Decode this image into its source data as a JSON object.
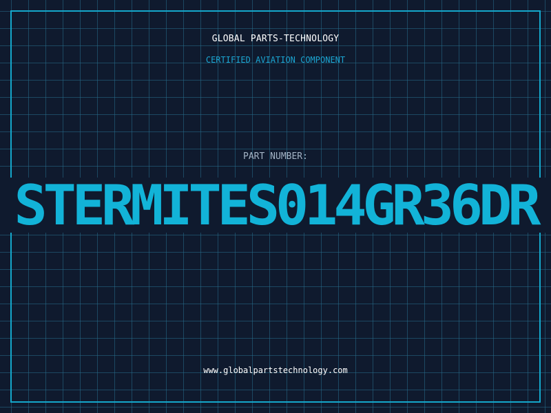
{
  "header": {
    "company": "GLOBAL PARTS-TECHNOLOGY",
    "tagline": "CERTIFIED AVIATION COMPONENT"
  },
  "part": {
    "label": "PART NUMBER:",
    "number": "STERMITES014GR36DR"
  },
  "footer": {
    "url": "www.globalpartstechnology.com"
  },
  "colors": {
    "background": "#0f1a2e",
    "accent": "#14a8cc",
    "grid": "#266e8c",
    "label": "#a4b4c6",
    "text": "#ffffff"
  }
}
